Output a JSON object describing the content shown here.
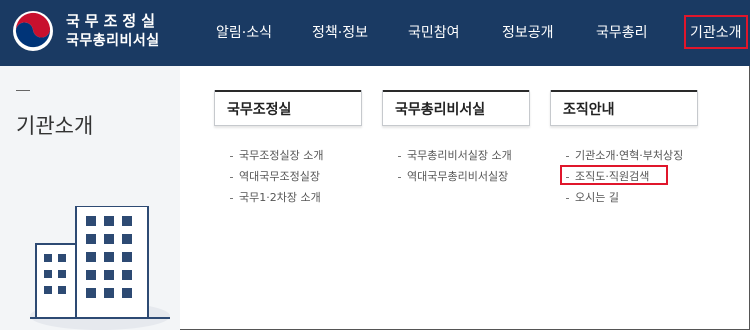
{
  "brand": {
    "line1": "국무조정실",
    "line2": "국무총리비서실"
  },
  "nav": [
    {
      "label": "알림·소식"
    },
    {
      "label": "정책·정보"
    },
    {
      "label": "국민참여"
    },
    {
      "label": "정보공개"
    },
    {
      "label": "국무총리"
    },
    {
      "label": "기관소개",
      "active": true
    }
  ],
  "sidebar": {
    "title": "기관소개"
  },
  "columns": [
    {
      "heading": "국무조정실",
      "items": [
        "국무조정실장 소개",
        "역대국무조정실장",
        "국무1·2차장 소개"
      ]
    },
    {
      "heading": "국무총리비서실",
      "items": [
        "국무총리비서실장 소개",
        "역대국무총리비서실장"
      ]
    },
    {
      "heading": "조직안내",
      "items": [
        "기관소개·연혁·부처상징",
        "조직도·직원검색",
        "오시는 길"
      ]
    }
  ],
  "colors": {
    "header_bg": "#1a3a63",
    "highlight": "#e0162b",
    "sidebar_bg": "#f3f5f7"
  }
}
